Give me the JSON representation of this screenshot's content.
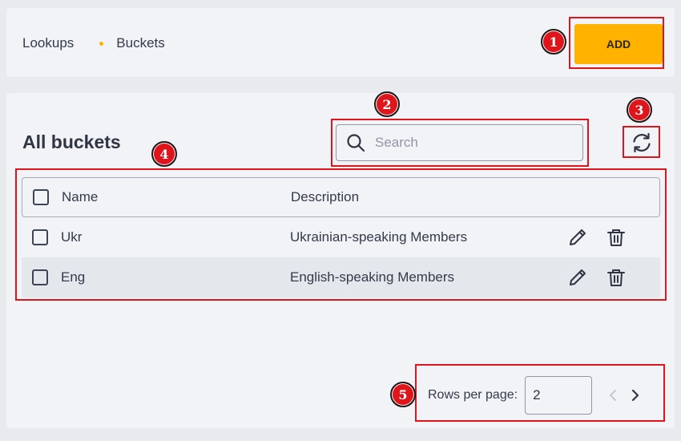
{
  "breadcrumb": {
    "root": "Lookups",
    "current": "Buckets"
  },
  "toolbar": {
    "add_label": "ADD"
  },
  "main": {
    "title": "All buckets",
    "search_placeholder": "Search",
    "search_value": ""
  },
  "table": {
    "columns": [
      "Name",
      "Description"
    ],
    "rows": [
      {
        "name": "Ukr",
        "description": "Ukrainian-speaking Members"
      },
      {
        "name": "Eng",
        "description": "English-speaking Members"
      }
    ]
  },
  "pagination": {
    "rows_per_page_label": "Rows per page:",
    "rows_per_page_value": "2"
  },
  "annotations": [
    "1",
    "2",
    "3",
    "4",
    "5"
  ],
  "colors": {
    "accent": "#ffb300",
    "highlight": "#e0141b",
    "panel": "#f1f3f6",
    "text": "#2f3542"
  },
  "icons": [
    "search-icon",
    "refresh-icon",
    "edit-icon",
    "delete-icon",
    "chevron-left-icon",
    "chevron-right-icon"
  ]
}
